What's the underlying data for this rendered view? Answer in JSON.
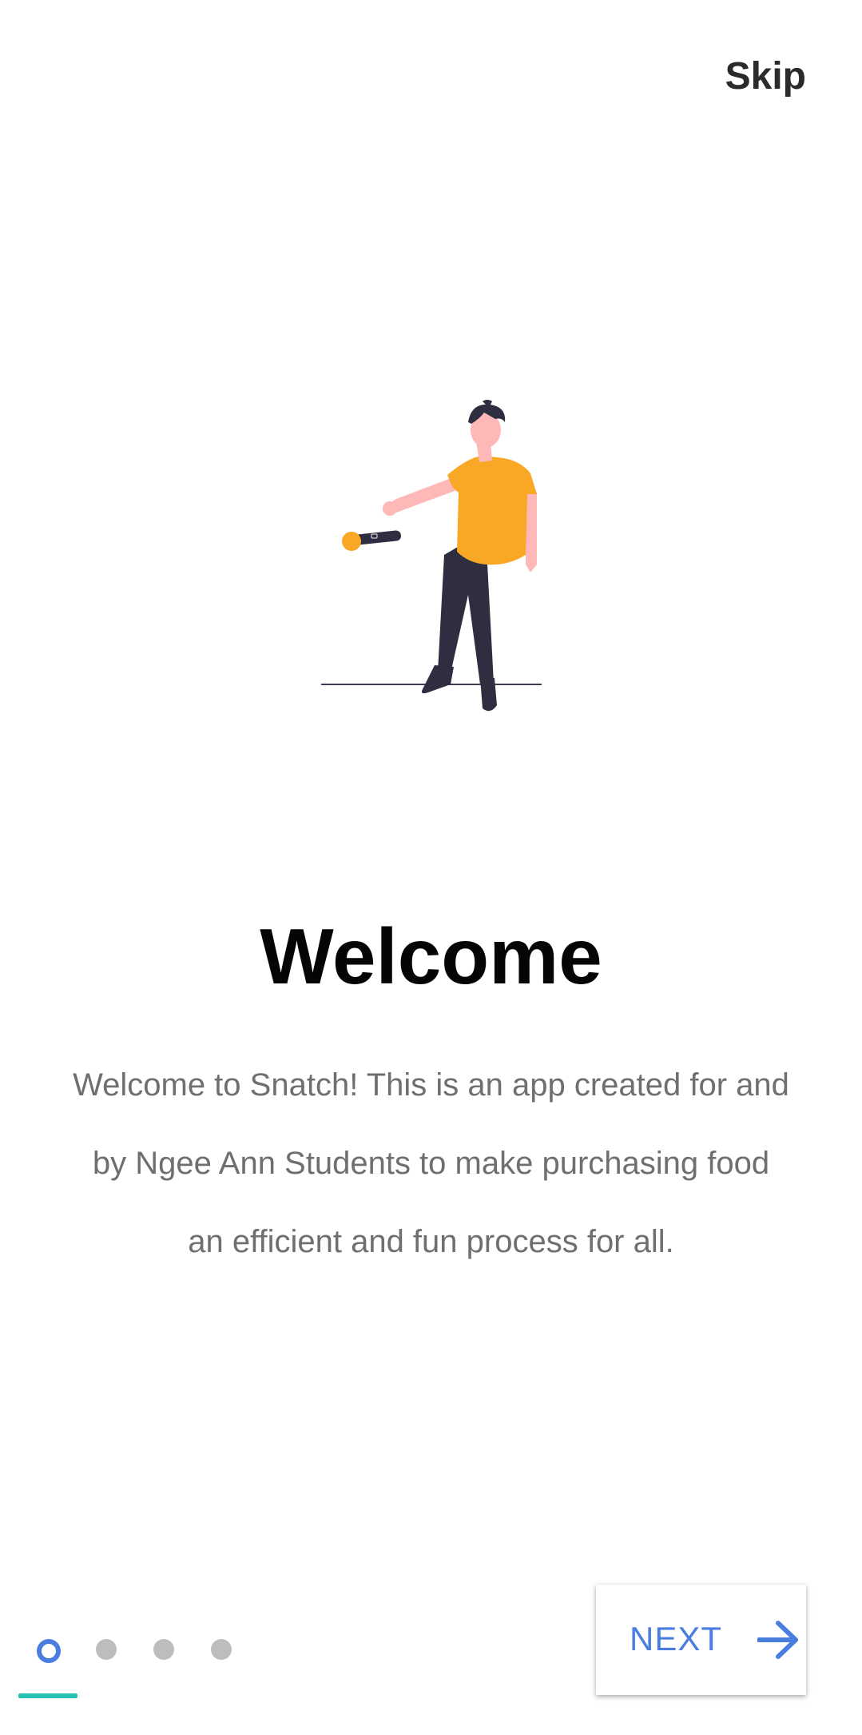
{
  "header": {
    "skip_label": "Skip"
  },
  "illustration": {
    "icon": "person-dropping-microphone-illustration",
    "colors": {
      "shirt": "#f9a826",
      "pants": "#2f2e41",
      "skin": "#ffb8b8",
      "microphone_head": "#f9a826"
    }
  },
  "onboarding": {
    "title": "Welcome",
    "description": "Welcome to Snatch! This is an app created for and by Ngee Ann Students to make purchasing food an efficient and fun process for all."
  },
  "pager": {
    "total_pages": 4,
    "current_page": 1,
    "active_color": "#4a7de0",
    "inactive_color": "#bdbdbd",
    "indicator_color": "#27c2b4"
  },
  "footer": {
    "next_label": "NEXT",
    "next_icon": "arrow-right-icon",
    "accent_color": "#4a7de0"
  }
}
